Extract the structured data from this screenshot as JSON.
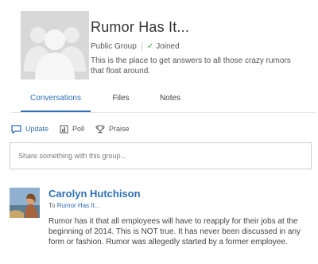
{
  "group": {
    "title": "Rumor Has It...",
    "type": "Public Group",
    "status": "Joined",
    "description": "This is the place to get answers to all those crazy rumors that float around."
  },
  "tabs": [
    {
      "label": "Conversations",
      "active": true
    },
    {
      "label": "Files",
      "active": false
    },
    {
      "label": "Notes",
      "active": false
    }
  ],
  "publisher": {
    "actions": [
      {
        "label": "Update",
        "icon": "speech-bubble-icon",
        "active": true
      },
      {
        "label": "Poll",
        "icon": "poll-icon",
        "active": false
      },
      {
        "label": "Praise",
        "icon": "trophy-icon",
        "active": false
      }
    ],
    "placeholder": "Share something with this group..."
  },
  "post": {
    "author": "Carolyn Hutchison",
    "to_prefix": "To",
    "to_group": "Rumor Has It...",
    "body": "Rumor has it that all employees will have to reapply for their jobs at the beginning of 2014. This is NOT true. It has never been discussed in any form or fashion. Rumor was allegedly started by a former employee."
  },
  "colors": {
    "accent": "#2f6fb5",
    "joined": "#3aa33a",
    "avatar_bg": "#d8d8d8"
  }
}
